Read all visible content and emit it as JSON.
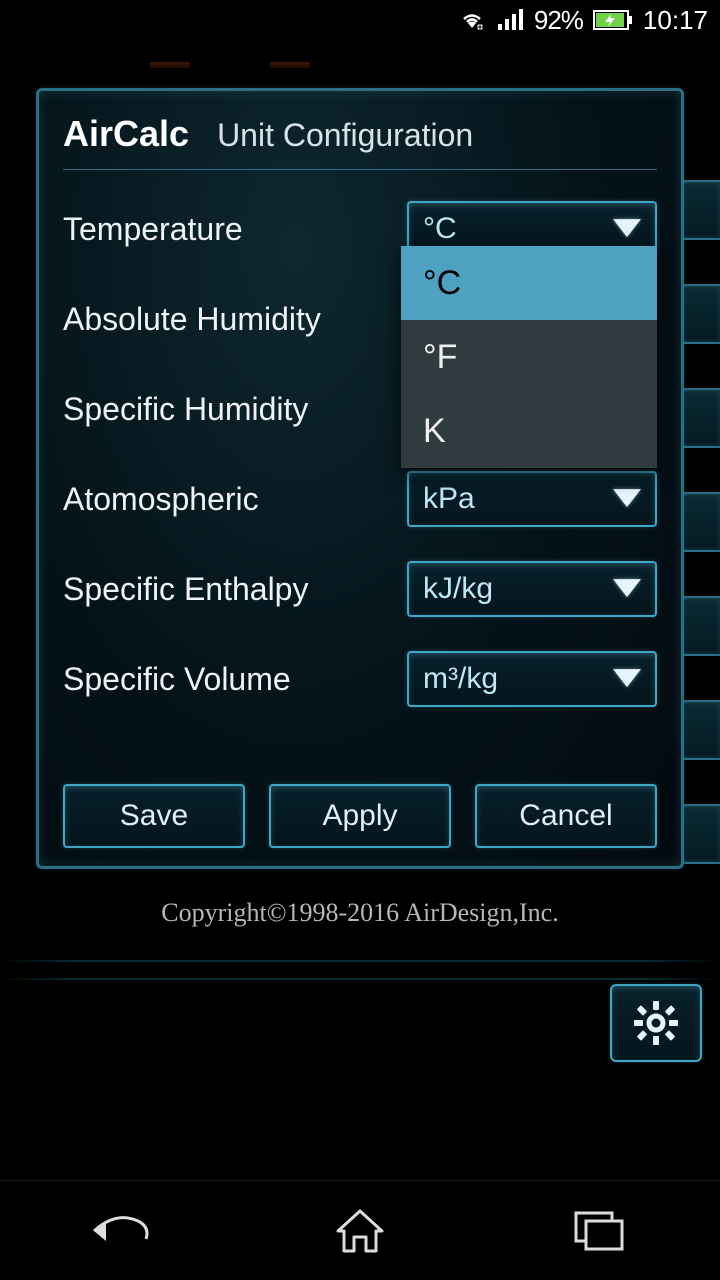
{
  "status_bar": {
    "battery_pct": "92%",
    "clock": "10:17"
  },
  "dialog": {
    "app_name": "AirCalc",
    "title": "Unit Configuration",
    "rows": [
      {
        "label": "Temperature",
        "value": "°C"
      },
      {
        "label": "Absolute Humidity",
        "value": ""
      },
      {
        "label": "Specific Humidity",
        "value": ""
      },
      {
        "label": "Atomospheric",
        "value": "kPa"
      },
      {
        "label": "Specific Enthalpy",
        "value": "kJ/kg"
      },
      {
        "label": "Specific Volume",
        "value": "m³/kg"
      }
    ],
    "dropdown": {
      "options": [
        "°C",
        "°F",
        "K"
      ],
      "selected": "°C"
    },
    "buttons": {
      "save": "Save",
      "apply": "Apply",
      "cancel": "Cancel"
    }
  },
  "copyright": "Copyright©1998-2016 AirDesign,Inc."
}
